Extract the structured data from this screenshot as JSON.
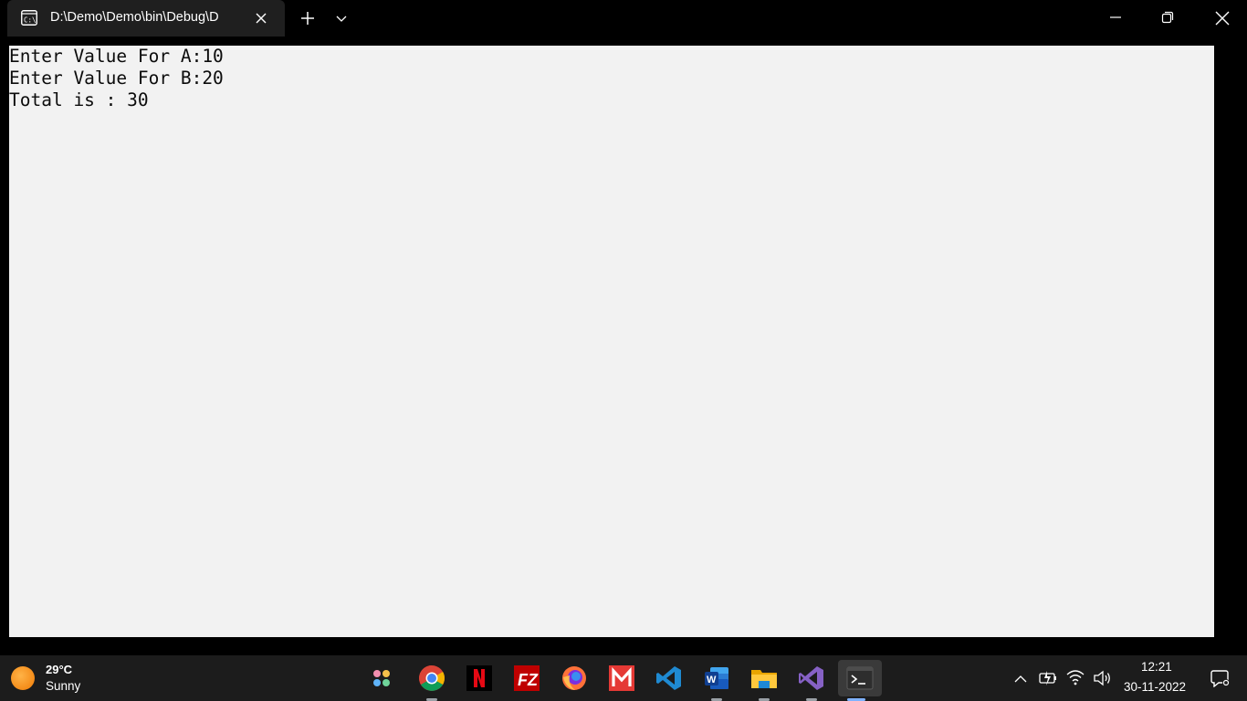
{
  "window": {
    "tab_title": "D:\\Demo\\Demo\\bin\\Debug\\D",
    "tab_icon": "console-icon"
  },
  "console": {
    "lines": [
      "Enter Value For A:10",
      "Enter Value For B:20",
      "Total is : 30"
    ],
    "background": "#f2f2f2",
    "foreground": "#0c0c0c"
  },
  "taskbar": {
    "weather": {
      "temperature": "29°C",
      "condition": "Sunny"
    },
    "apps": [
      {
        "name": "widgets"
      },
      {
        "name": "chrome"
      },
      {
        "name": "netflix"
      },
      {
        "name": "filezilla"
      },
      {
        "name": "firefox"
      },
      {
        "name": "gmail"
      },
      {
        "name": "vscode"
      },
      {
        "name": "word"
      },
      {
        "name": "file-explorer"
      },
      {
        "name": "visual-studio"
      },
      {
        "name": "terminal",
        "active": true
      }
    ],
    "clock": {
      "time": "12:21",
      "date": "30-11-2022"
    }
  }
}
